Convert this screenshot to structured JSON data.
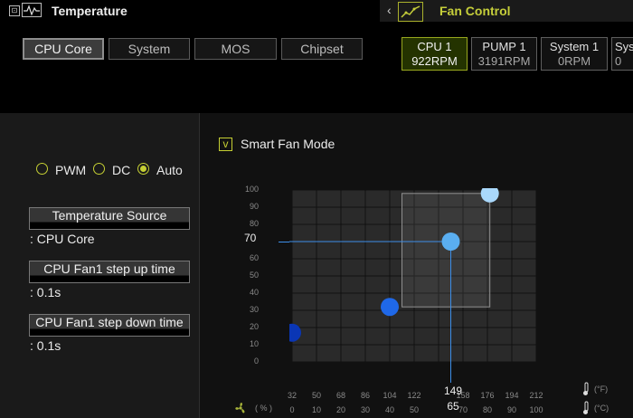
{
  "header": {
    "title": "Temperature",
    "fan_control_title": "Fan Control",
    "arrow": "‹"
  },
  "temp_sources": [
    {
      "label": "CPU Core",
      "active": true
    },
    {
      "label": "System",
      "active": false
    },
    {
      "label": "MOS",
      "active": false
    },
    {
      "label": "Chipset",
      "active": false
    }
  ],
  "fans": [
    {
      "name": "CPU 1",
      "rpm": "922RPM",
      "active": true
    },
    {
      "name": "PUMP 1",
      "rpm": "3191RPM",
      "active": false
    },
    {
      "name": "System 1",
      "rpm": "0RPM",
      "active": false
    },
    {
      "name": "Syste",
      "rpm": "0",
      "active": false
    }
  ],
  "mode": {
    "options": [
      "PWM",
      "DC",
      "Auto"
    ],
    "selected": "Auto"
  },
  "settings": {
    "temp_source_label": "Temperature Source",
    "temp_source_value": ": CPU Core",
    "step_up_label": "CPU Fan1 step up time",
    "step_up_value": ": 0.1s",
    "step_down_label": "CPU Fan1 step down time",
    "step_down_value": ": 0.1s"
  },
  "smart_fan": {
    "label": "Smart Fan Mode",
    "checked": true,
    "check_glyph": "v"
  },
  "graph": {
    "y_ticks": [
      "100",
      "90",
      "80",
      "70",
      "60",
      "50",
      "40",
      "30",
      "20",
      "10",
      "0"
    ],
    "x_ticks_f": [
      "32",
      "50",
      "68",
      "86",
      "104",
      "122",
      "140",
      "158",
      "176",
      "194",
      "212"
    ],
    "x_ticks_c": [
      "0",
      "10",
      "20",
      "30",
      "40",
      "50",
      "60",
      "70",
      "80",
      "90",
      "100"
    ],
    "y_unit": "( % )",
    "unit_f": "(°F)",
    "unit_c": "(°C)",
    "marker_y": "70",
    "marker_x_f": "149",
    "marker_x_c": "65",
    "points": [
      {
        "temp_c": 0,
        "fan_pct": 17
      },
      {
        "temp_c": 40,
        "fan_pct": 32
      },
      {
        "temp_c": 65,
        "fan_pct": 70
      },
      {
        "temp_c": 81,
        "fan_pct": 98
      }
    ],
    "selected_point_index": 2,
    "colors": {
      "accent": "#c5cf33",
      "line": "#3d8ee8",
      "point_dark": "#0a36b5",
      "point_mid": "#1f68e8",
      "point_light": "#5aaef0",
      "point_lightest": "#a9d8fb"
    }
  }
}
